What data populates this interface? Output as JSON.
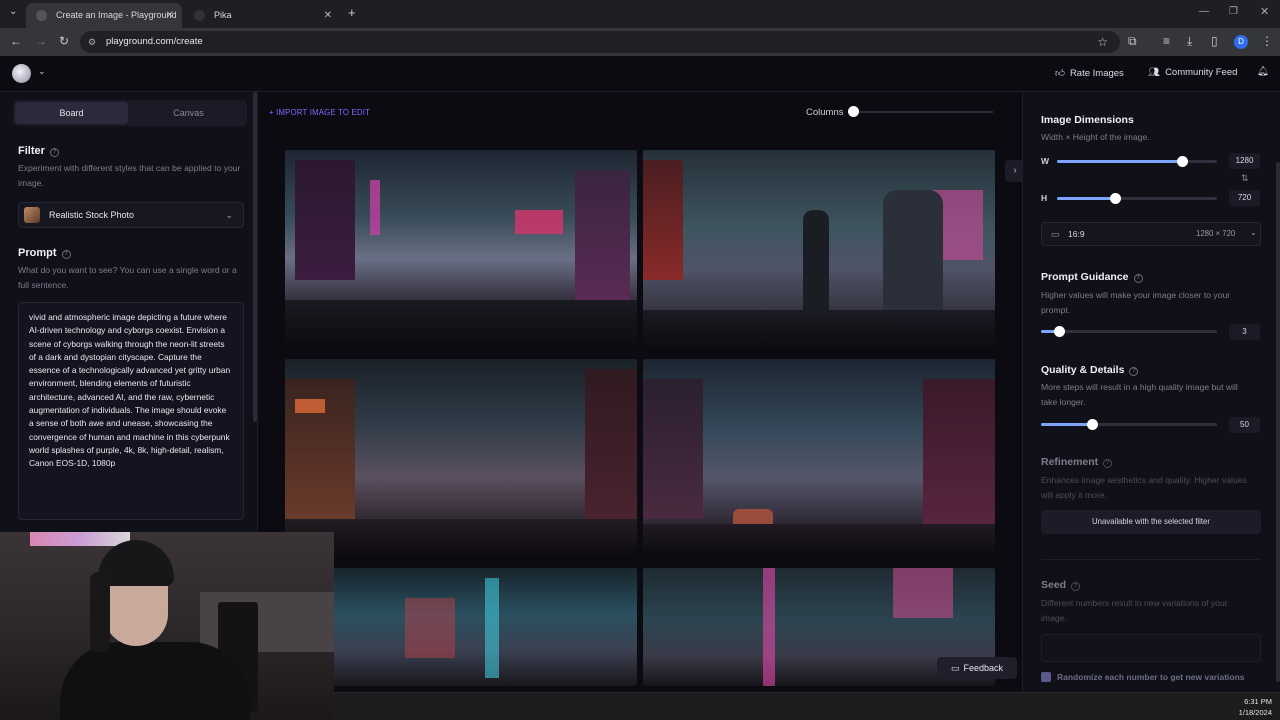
{
  "browser": {
    "tabs": [
      {
        "label": "Create an Image - Playground",
        "active": true
      },
      {
        "label": "Pika",
        "active": false
      }
    ],
    "url": "playground.com/create",
    "profile_initial": "D"
  },
  "header": {
    "rate_images": "Rate Images",
    "community_feed": "Community Feed"
  },
  "left": {
    "tabs": [
      "Board",
      "Canvas"
    ],
    "filter": {
      "title": "Filter",
      "desc": "Experiment with different styles that can be applied to your image.",
      "selected": "Realistic Stock Photo"
    },
    "prompt": {
      "title": "Prompt",
      "desc": "What do you want to see? You can use a single word or a full sentence.",
      "text": "vivid and atmospheric image depicting a future where AI-driven technology and cyborgs coexist. Envision a scene of cyborgs walking through the neon-lit streets of a dark and dystopian cityscape. Capture the essence of a technologically advanced yet gritty urban environment, blending elements of futuristic architecture, advanced AI, and the raw, cybernetic augmentation of individuals. The image should evoke a sense of both awe and unease, showcasing the convergence of human and machine in this cyberpunk world splashes of purple, 4k, 8k, high-detail, realism, Canon EOS-1D, 1080p"
    }
  },
  "center": {
    "import_label": "+ IMPORT IMAGE TO EDIT",
    "columns_label": "Columns",
    "columns_level": 0,
    "feedback_label": "Feedback"
  },
  "right": {
    "dimensions": {
      "title": "Image Dimensions",
      "desc": "Width × Height of the image.",
      "w_label": "W",
      "h_label": "H",
      "width": "1280",
      "height": "720",
      "width_fraction": 0.78,
      "height_fraction": 0.36,
      "ratio": "16:9",
      "ratio_detail": "1280 × 720"
    },
    "guidance": {
      "title": "Prompt Guidance",
      "desc": "Higher values will make your image closer to your prompt.",
      "value": "3",
      "fraction": 0.1
    },
    "quality": {
      "title": "Quality & Details",
      "desc": "More steps will result in a high quality image but will take longer.",
      "value": "50",
      "fraction": 0.29
    },
    "refinement": {
      "title": "Refinement",
      "desc": "Enhances image aesthetics and quality. Higher values will apply it more.",
      "unavailable": "Unavailable with the selected filter"
    },
    "seed": {
      "title": "Seed",
      "desc": "Different numbers result in new variations of your image.",
      "randomize": "Randomize each number to get new variations"
    }
  },
  "taskbar": {
    "time": "6:31 PM",
    "date": "1/18/2024"
  },
  "colors": {
    "accent": "#7f6cff",
    "slider_fill": "#7da4ff"
  }
}
